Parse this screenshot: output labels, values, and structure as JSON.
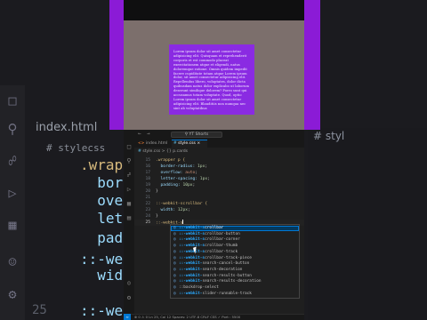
{
  "background_editor": {
    "tab": "index.html",
    "crumb": "# stylecss",
    "lines": [
      {
        "ln": "",
        "text": ".wrapper p {",
        "sel": true
      },
      {
        "ln": "",
        "text": "  border"
      },
      {
        "ln": "",
        "text": "  overfl"
      },
      {
        "ln": "",
        "text": "  letter"
      },
      {
        "ln": "",
        "text": "  paddin"
      },
      {
        "ln": "",
        "text": ""
      },
      {
        "ln": "",
        "text": "::-webkit"
      },
      {
        "ln": "",
        "text": "  width:"
      },
      {
        "ln": "25",
        "text": "::-webkit-"
      }
    ],
    "right_tab": "# styl"
  },
  "preview": {
    "paragraph": "Lorem ipsum dolor sit amet consectetur adipisicing elit. Quisquam et reprehenderit corporis et est commodo placeat exercitationem atque et eligendi, natus doloremque ratione. Omnis quidem impedit facere cupiditate totam atque Lorem ipsum dolor, sit amet consectetur adipisicing elit. Repellendus libero, voluptates, dolor dicta quibusdam natus dolor explicabo ut laborum deserunt similique dolorem? Porro sunt qui accusamus totam voluptate. Quod, optio Lorem ipsum dolor sit amet consectetur adipisicing elit. Blanditiis non numqua nec sint ab voluptatibus"
  },
  "editor": {
    "search_placeholder": "YT Shorts",
    "tabs": [
      {
        "label": "index.html",
        "kind": "html",
        "icon": "<>"
      },
      {
        "label": "style.css",
        "kind": "css",
        "icon": "#",
        "active": true,
        "close": "×"
      }
    ],
    "breadcrumb": {
      "file": "style.css",
      "separator": ">",
      "symbol": "{} p.cards"
    },
    "code_lines": [
      {
        "ln": "15",
        "parts": [
          {
            "t": ".wrapper p {",
            "c": "sel"
          }
        ]
      },
      {
        "ln": "16",
        "parts": [
          {
            "t": "  border-radius: ",
            "c": "prop"
          },
          {
            "t": "1px",
            "c": "num"
          },
          {
            "t": ";",
            "c": "punc"
          }
        ]
      },
      {
        "ln": "17",
        "parts": [
          {
            "t": "  overflow: ",
            "c": "prop"
          },
          {
            "t": "auto",
            "c": "val"
          },
          {
            "t": ";",
            "c": "punc"
          }
        ]
      },
      {
        "ln": "18",
        "parts": [
          {
            "t": "  letter-spacing: ",
            "c": "prop"
          },
          {
            "t": "1px",
            "c": "num"
          },
          {
            "t": ";",
            "c": "punc"
          }
        ]
      },
      {
        "ln": "19",
        "parts": [
          {
            "t": "  padding: ",
            "c": "prop"
          },
          {
            "t": "10px",
            "c": "num"
          },
          {
            "t": ";",
            "c": "punc"
          }
        ]
      },
      {
        "ln": "20",
        "parts": [
          {
            "t": "}",
            "c": "punc"
          }
        ]
      },
      {
        "ln": "21",
        "parts": [
          {
            "t": "",
            "c": "punc"
          }
        ]
      },
      {
        "ln": "22",
        "parts": [
          {
            "t": "::-webkit-scrollbar {",
            "c": "sel"
          }
        ]
      },
      {
        "ln": "23",
        "parts": [
          {
            "t": "  width: ",
            "c": "prop"
          },
          {
            "t": "12px",
            "c": "num"
          },
          {
            "t": ";",
            "c": "punc"
          }
        ]
      },
      {
        "ln": "24",
        "parts": [
          {
            "t": "}",
            "c": "punc"
          }
        ]
      },
      {
        "ln": "25",
        "parts": [
          {
            "t": "::-webkit-s",
            "c": "sel"
          }
        ],
        "current": true
      }
    ],
    "suggestions": [
      {
        "prefix": "::-webkit-s",
        "rest": "crollbar",
        "active": true
      },
      {
        "prefix": "::-webkit-s",
        "rest": "crollbar-button"
      },
      {
        "prefix": "::-webkit-s",
        "rest": "crollbar-corner"
      },
      {
        "prefix": "::-webkit-s",
        "rest": "crollbar-thumb"
      },
      {
        "prefix": "::-webkit-s",
        "rest": "crollbar-track"
      },
      {
        "prefix": "::-webkit-s",
        "rest": "crollbar-track-piece"
      },
      {
        "prefix": "::-webkit-",
        "rest": "search-cancel-button"
      },
      {
        "prefix": "::-webkit-",
        "rest": "search-decoration"
      },
      {
        "prefix": "::-webkit-",
        "rest": "search-results-button"
      },
      {
        "prefix": "::-webkit-",
        "rest": "search-results-decoration"
      },
      {
        "prefix": "",
        "rest": "::backdrop-select"
      },
      {
        "prefix": "::-webkit-",
        "rest": "slider-runnable-track"
      }
    ],
    "status_text": "⊗ 0 ⚠ 0   Ln 25, Col 12   Spaces: 2   UTF-8   CRLF   CSS   ✓ Port : 5500"
  },
  "colors": {
    "accent": "#0078d4",
    "preview_box": "#8a2be2",
    "preview_bg": "#7c6f6c"
  }
}
